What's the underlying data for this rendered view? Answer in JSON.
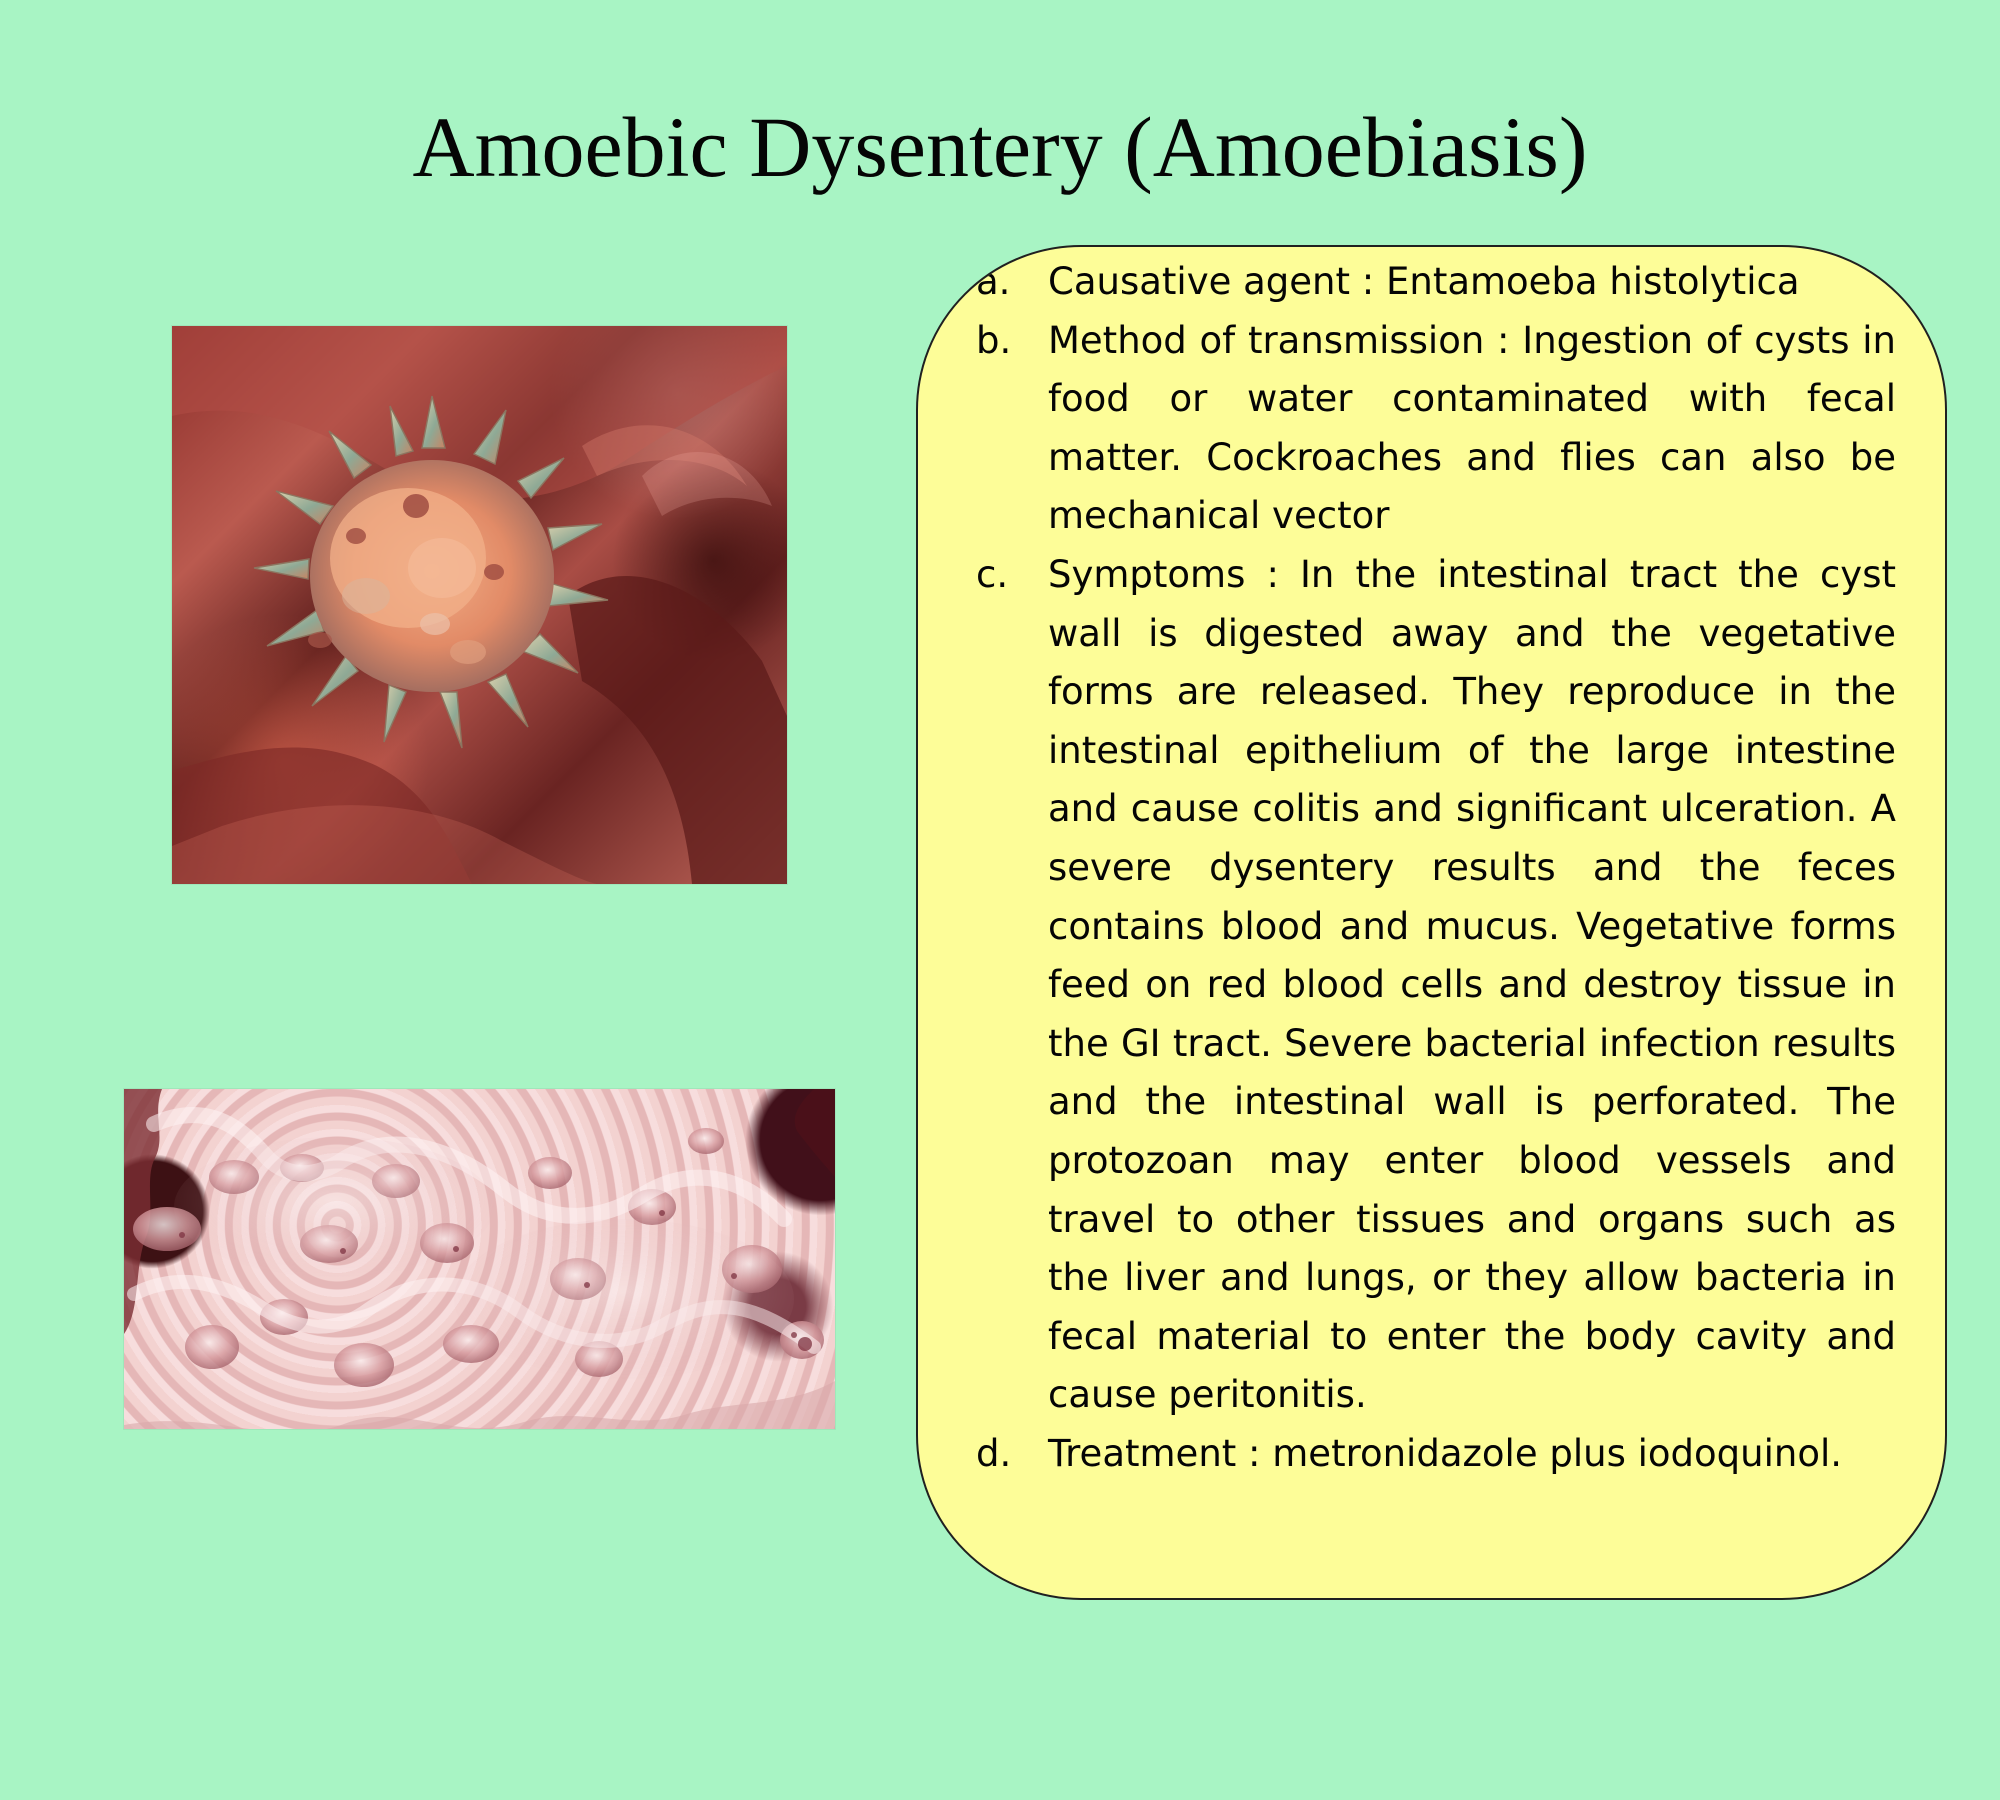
{
  "slide": {
    "title": "Amoebic Dysentery (Amoebiasis)"
  },
  "images": [
    {
      "name": "amoeba-illustration",
      "kind": "Entamoeba illustration"
    },
    {
      "name": "intestinal-ulcers-photo",
      "kind": "intestinal ulcer photo"
    }
  ],
  "info": {
    "items": [
      {
        "letter": "a.",
        "text": "Causative agent : Entamoeba histolytica"
      },
      {
        "letter": "b.",
        "text": "Method of transmission : Ingestion of cysts in food or water contaminated with fecal matter. Cockroaches and flies can also be mechanical vector"
      },
      {
        "letter": "c.",
        "text": "Symptoms : In the intestinal tract the cyst wall is digested away and the vegetative forms are released. They reproduce in the intestinal epithelium of the large intestine and cause colitis and significant ulceration. A severe dysentery results and the feces contains blood and mucus. Vegetative forms feed on red blood cells and destroy tissue in the GI tract. Severe bacterial infection results and the intestinal wall is perforated. The protozoan may enter blood vessels and travel to other tissues and organs such as the liver and lungs, or they allow bacteria in fecal material to enter the body cavity and cause peritonitis."
      },
      {
        "letter": "d.",
        "text": "Treatment : metronidazole plus iodoquinol."
      }
    ]
  },
  "colors": {
    "background": "#a8f4c4",
    "box_fill": "#fdfd98",
    "text": "#050505"
  }
}
